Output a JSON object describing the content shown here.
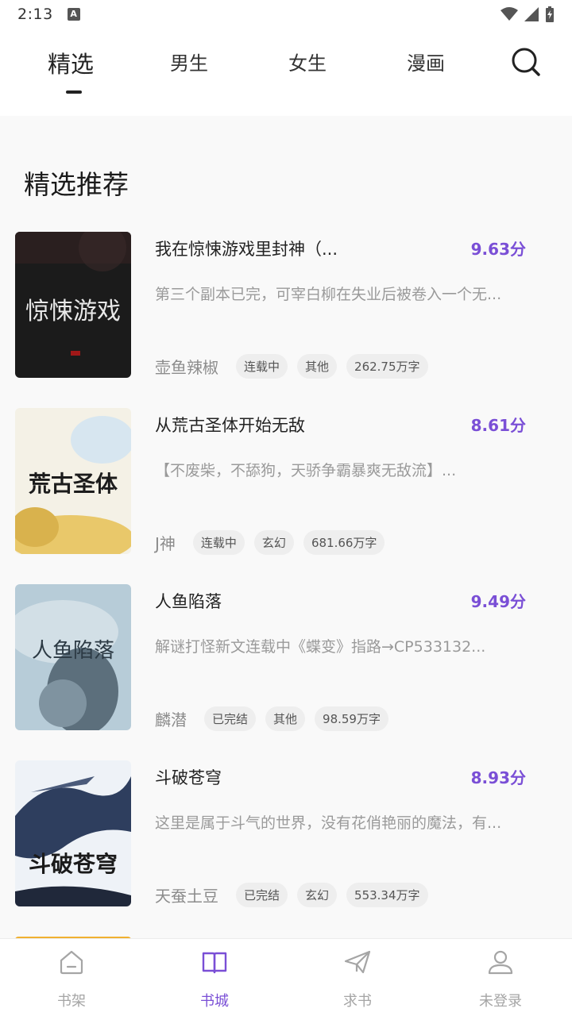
{
  "status_bar": {
    "time": "2:13"
  },
  "tabs": [
    {
      "label": "精选",
      "active": true
    },
    {
      "label": "男生",
      "active": false
    },
    {
      "label": "女生",
      "active": false
    },
    {
      "label": "漫画",
      "active": false
    }
  ],
  "section_title": "精选推荐",
  "books": [
    {
      "title": "我在惊悚游戏里封神（...",
      "score": "9.63分",
      "desc": "第三个副本已完，可宰白柳在失业后被卷入一个无...",
      "author": "壶鱼辣椒",
      "tags": [
        "连载中",
        "其他",
        "262.75万字"
      ],
      "cover_text": "惊悚游戏"
    },
    {
      "title": "从荒古圣体开始无敌",
      "score": "8.61分",
      "desc": "【不废柴，不舔狗，天骄争霸暴爽无敌流】...",
      "author": "J神",
      "tags": [
        "连载中",
        "玄幻",
        "681.66万字"
      ],
      "cover_text": "荒古圣体"
    },
    {
      "title": "人鱼陷落",
      "score": "9.49分",
      "desc": "解谜打怪新文连载中《蝶变》指路→CP533132...",
      "author": "麟潜",
      "tags": [
        "已完结",
        "其他",
        "98.59万字"
      ],
      "cover_text": "人鱼陷落"
    },
    {
      "title": "斗破苍穹",
      "score": "8.93分",
      "desc": "这里是属于斗气的世界，没有花俏艳丽的魔法，有...",
      "author": "天蚕土豆",
      "tags": [
        "已完结",
        "玄幻",
        "553.34万字"
      ],
      "cover_text": "斗破苍穹"
    }
  ],
  "bottom_nav": [
    {
      "label": "书架",
      "icon": "home-icon",
      "active": false
    },
    {
      "label": "书城",
      "icon": "book-icon",
      "active": true
    },
    {
      "label": "求书",
      "icon": "paper-plane-icon",
      "active": false
    },
    {
      "label": "未登录",
      "icon": "user-icon",
      "active": false
    }
  ],
  "colors": {
    "accent": "#7a4fd6",
    "muted": "#a5a5a5"
  }
}
